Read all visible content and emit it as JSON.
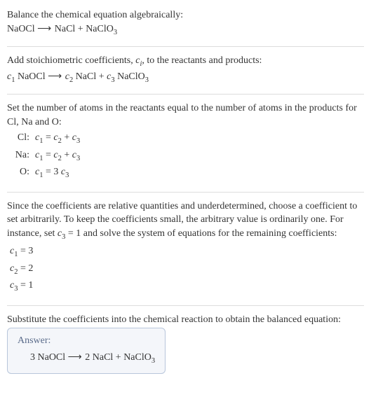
{
  "intro": {
    "line1_plain": "Balance the chemical equation algebraically:",
    "reaction_html": "NaOCl <span class=\"arrow\">⟶</span> NaCl + NaClO<sub>3</sub>"
  },
  "step_coeffs": {
    "text_html": "Add stoichiometric coefficients, <span class=\"italic\">c<sub>i</sub></span>, to the reactants and products:",
    "reaction_html": "<span class=\"italic\">c</span><sub>1</sub> NaOCl <span class=\"arrow\">⟶</span> <span class=\"italic\">c</span><sub>2</sub> NaCl + <span class=\"italic\">c</span><sub>3</sub> NaClO<sub>3</sub>"
  },
  "step_atoms": {
    "text": "Set the number of atoms in the reactants equal to the number of atoms in the products for Cl, Na and O:",
    "rows": [
      {
        "label": "Cl:",
        "eq_html": "<span class=\"italic\">c</span><sub>1</sub> = <span class=\"italic\">c</span><sub>2</sub> + <span class=\"italic\">c</span><sub>3</sub>"
      },
      {
        "label": "Na:",
        "eq_html": "<span class=\"italic\">c</span><sub>1</sub> = <span class=\"italic\">c</span><sub>2</sub> + <span class=\"italic\">c</span><sub>3</sub>"
      },
      {
        "label": "O:",
        "eq_html": "<span class=\"italic\">c</span><sub>1</sub> = 3 <span class=\"italic\">c</span><sub>3</sub>"
      }
    ]
  },
  "step_solve": {
    "text_html": "Since the coefficients are relative quantities and underdetermined, choose a coefficient to set arbitrarily. To keep the coefficients small, the arbitrary value is ordinarily one. For instance, set <span class=\"italic\">c</span><sub>3</sub> = 1 and solve the system of equations for the remaining coefficients:",
    "rows": [
      {
        "eq_html": "<span class=\"italic\">c</span><sub>1</sub> = 3"
      },
      {
        "eq_html": "<span class=\"italic\">c</span><sub>2</sub> = 2"
      },
      {
        "eq_html": "<span class=\"italic\">c</span><sub>3</sub> = 1"
      }
    ]
  },
  "step_sub": {
    "text": "Substitute the coefficients into the chemical reaction to obtain the balanced equation:"
  },
  "answer": {
    "label": "Answer:",
    "reaction_html": "3 NaOCl <span class=\"arrow\">⟶</span> 2 NaCl + NaClO<sub>3</sub>"
  }
}
